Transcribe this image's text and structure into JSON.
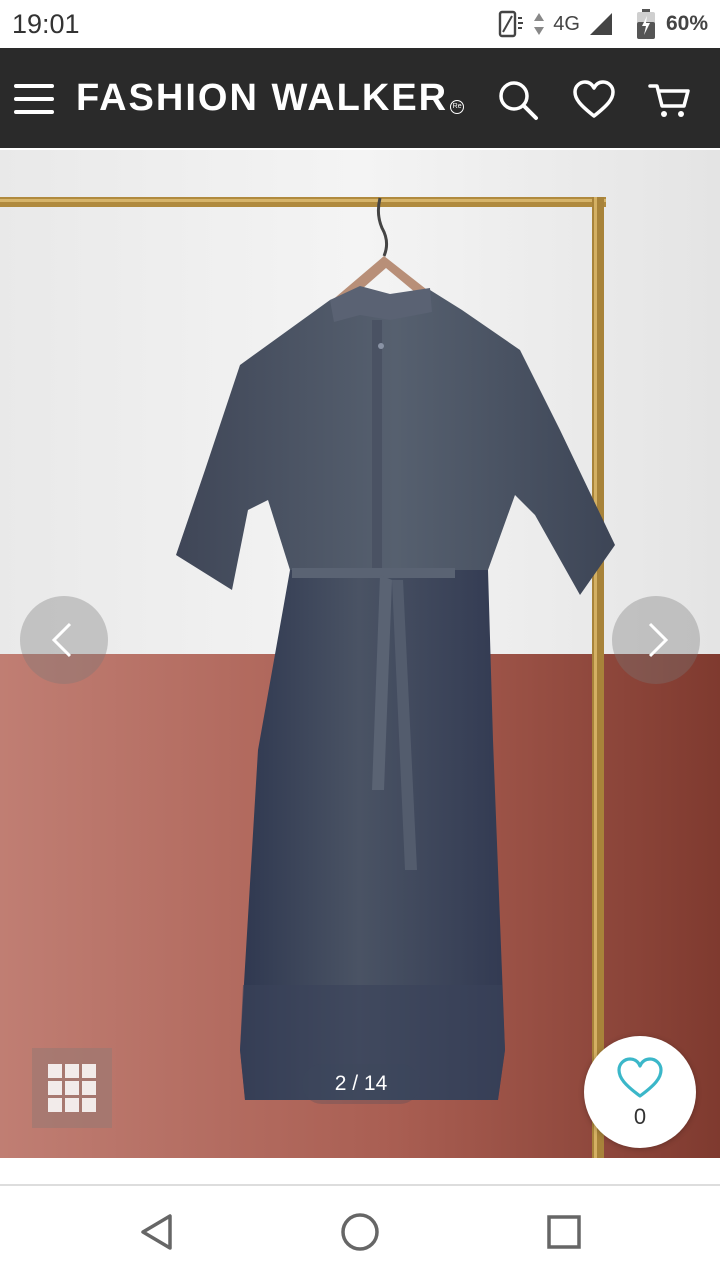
{
  "status_bar": {
    "time": "19:01",
    "network": "4G",
    "battery": "60%"
  },
  "header": {
    "logo": "FASHION WALKER",
    "logo_mark": "Re",
    "icons": [
      "menu-icon",
      "search-icon",
      "heart-icon",
      "cart-icon"
    ]
  },
  "gallery": {
    "counter": "2 / 14",
    "current_image": 2,
    "total_images": 14,
    "favorite_count": "0"
  },
  "colors": {
    "header_bg": "#2a2a2a",
    "accent": "#3bb7c9",
    "wall_top": "#eeeeee",
    "wall_bottom": "#b5675c",
    "dress": "#4c5566"
  },
  "system_nav": {
    "icons": [
      "back-icon",
      "home-icon",
      "recents-icon"
    ]
  }
}
